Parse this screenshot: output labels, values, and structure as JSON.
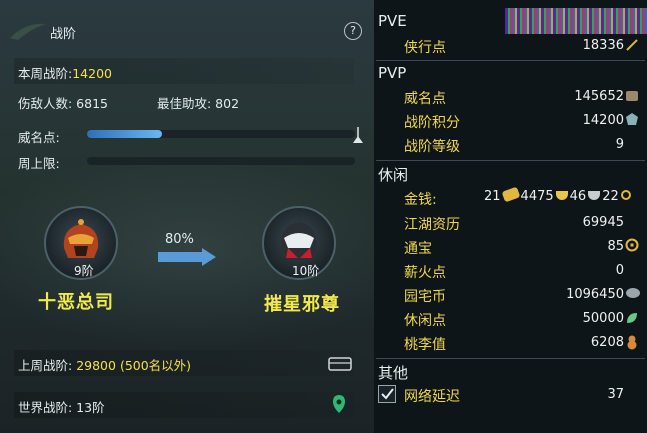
{
  "left": {
    "title": "战阶",
    "help": "?",
    "weekly_rank_label": "本周战阶:",
    "weekly_rank_value": "14200",
    "hurt_count": "伤敌人数: 6815",
    "best_assist": "最佳助攻: 802",
    "fame_label": "威名点:",
    "fame_progress": 0.28,
    "weekly_limit_label": "周上限:",
    "weekly_limit_progress": 0,
    "rank_left": {
      "level": "9阶",
      "name": "十恶总司"
    },
    "rank_right": {
      "level": "10阶",
      "name": "摧星邪尊"
    },
    "progress_text": "80%",
    "last_week_label": "上周战阶:",
    "last_week_value": "29800 (500名以外)",
    "world_rank": "世界战阶: 13阶"
  },
  "right": {
    "pve_title": "PVE",
    "pve": [
      {
        "label": "侠行点",
        "value": "18336"
      }
    ],
    "pvp_title": "PVP",
    "pvp": [
      {
        "label": "威名点",
        "value": "145652"
      },
      {
        "label": "战阶积分",
        "value": "14200"
      },
      {
        "label": "战阶等级",
        "value": "9"
      }
    ],
    "leisure_title": "休闲",
    "money_label": "金钱:",
    "money": {
      "gold": "21",
      "silver": "4475",
      "copper": "46",
      "wen": "22"
    },
    "leisure": [
      {
        "label": "江湖资历",
        "value": "69945"
      },
      {
        "label": "通宝",
        "value": "85"
      },
      {
        "label": "薪火点",
        "value": "0"
      },
      {
        "label": "园宅币",
        "value": "1096450"
      },
      {
        "label": "休闲点",
        "value": "50000"
      },
      {
        "label": "桃李值",
        "value": "6208"
      }
    ],
    "other_title": "其他",
    "latency_label": "网络延迟",
    "latency_value": "37"
  },
  "colors": {
    "accent": "#f5e04a",
    "bar": "#4a9ee0"
  }
}
